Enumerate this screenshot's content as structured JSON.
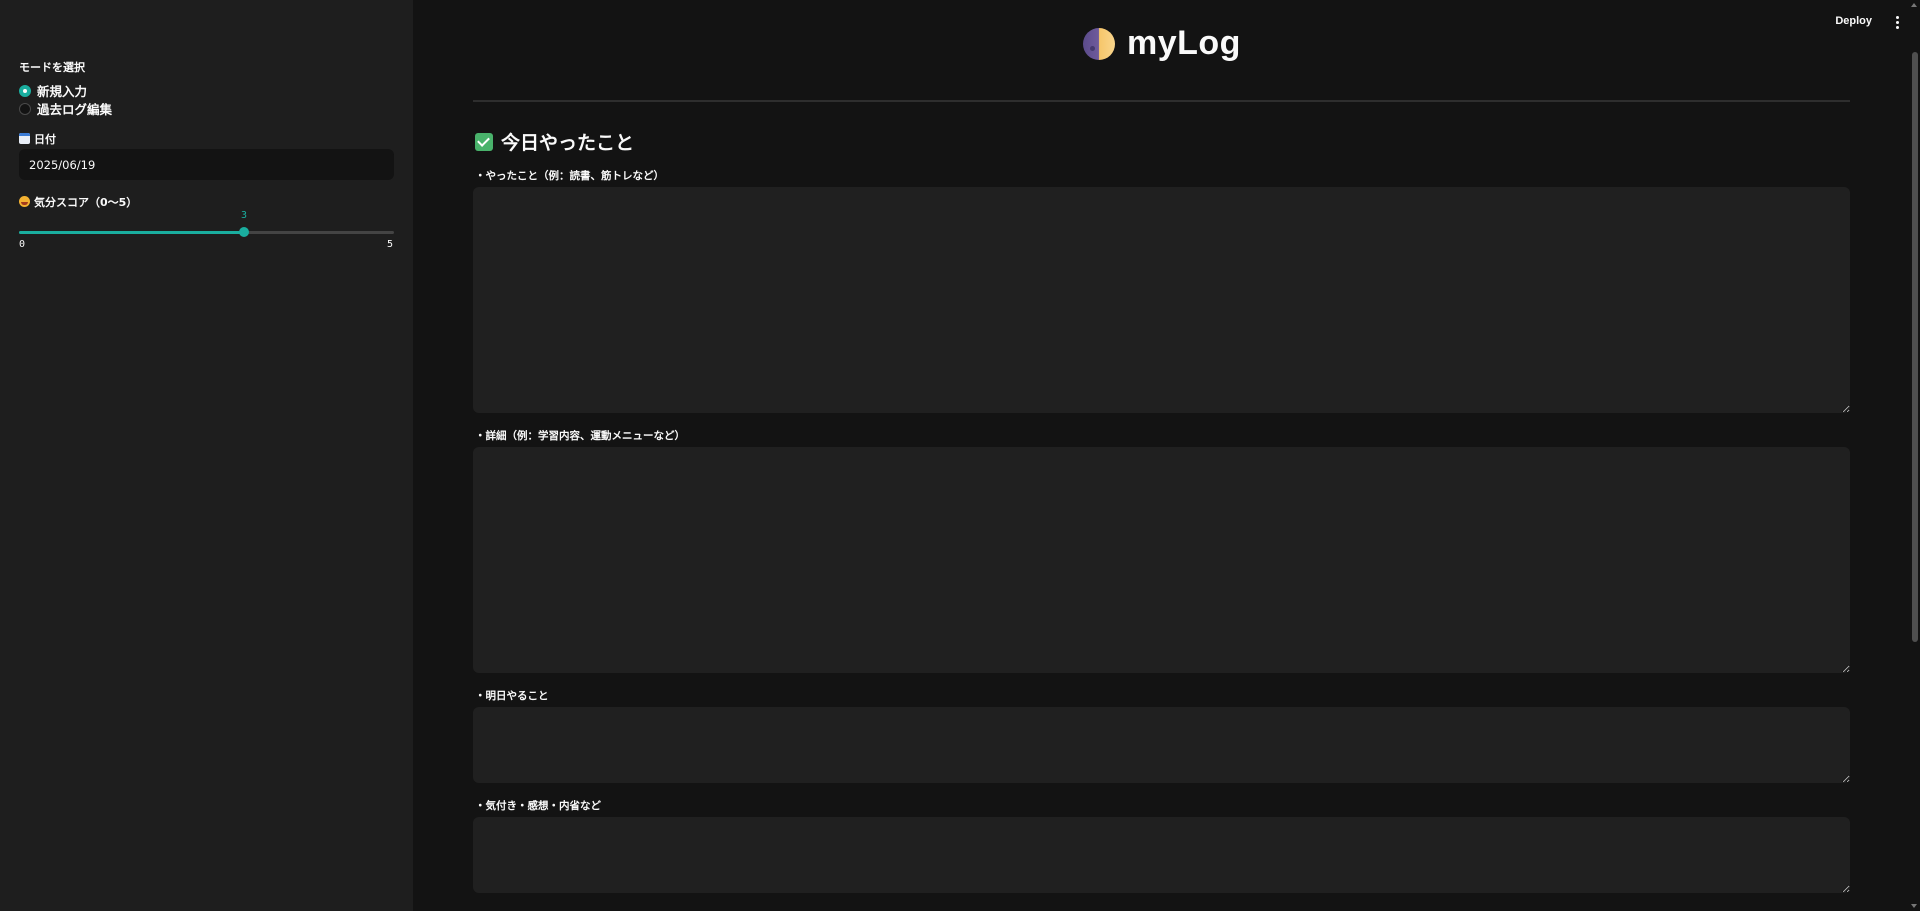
{
  "header": {
    "title": "myLog",
    "deploy_label": "Deploy"
  },
  "sidebar": {
    "mode_label": "モードを選択",
    "mode_options": [
      {
        "label": "新規入力",
        "selected": true
      },
      {
        "label": "過去ログ編集",
        "selected": false
      }
    ],
    "date_label": "日付",
    "date_value": "2025/06/19",
    "mood_label": "気分スコア（0〜5）",
    "mood": {
      "value": "3",
      "min": "0",
      "max": "5",
      "current": 3,
      "range_min": 0,
      "range_max": 5
    },
    "icons": {
      "date": "calendar-icon",
      "mood": "grinning-face-icon"
    }
  },
  "main": {
    "section_title": "今日やったこと",
    "section_icon": "check-mark-icon",
    "fields": [
      {
        "label": "・やったこと（例：読書、筋トレなど）",
        "value": ""
      },
      {
        "label": "・詳細（例：学習内容、運動メニューなど）",
        "value": ""
      },
      {
        "label": "・明日やること",
        "value": ""
      },
      {
        "label": "・気付き・感想・内省など",
        "value": ""
      }
    ]
  },
  "colors": {
    "accent": "#1aae9f",
    "sidebar_bg": "#1e1e1e",
    "main_bg": "#131313",
    "input_bg": "#202020"
  }
}
